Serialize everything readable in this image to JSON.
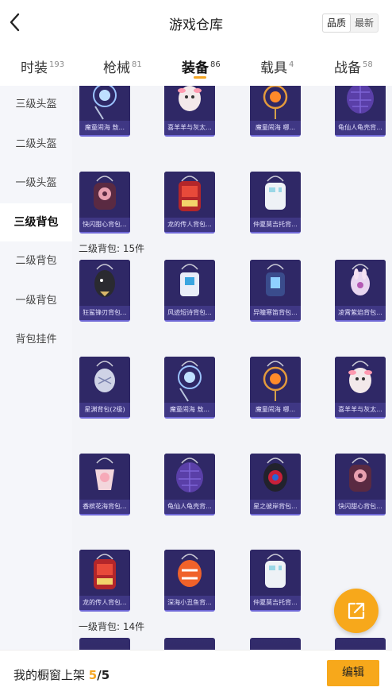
{
  "header": {
    "title": "游戏仓库",
    "sort_options": [
      "品质",
      "最新"
    ],
    "sort_selected": "品质"
  },
  "tabs": [
    {
      "label": "时装",
      "count": "193"
    },
    {
      "label": "枪械",
      "count": "81"
    },
    {
      "label": "装备",
      "count": "86",
      "active": true
    },
    {
      "label": "载具",
      "count": "4"
    },
    {
      "label": "战备",
      "count": "58"
    }
  ],
  "sidebar": {
    "items": [
      "三级头盔",
      "二级头盔",
      "一级头盔",
      "三级背包",
      "二级背包",
      "一级背包",
      "背包挂件"
    ],
    "active": "三级背包"
  },
  "sections": {
    "level2_title": "二级背包: 15件",
    "level1_title": "一级背包: 14件"
  },
  "items_top": [
    {
      "name": "魔童闹海 敖...",
      "icon": "blue-orb-backpack"
    },
    {
      "name": "喜羊羊与灰太...",
      "icon": "sheep-backpack"
    },
    {
      "name": "魔童闹海 哪...",
      "icon": "orange-orb-backpack"
    },
    {
      "name": "龟仙人龟壳背...",
      "icon": "turtle-shell-backpack"
    },
    {
      "name": "快闪甜心背包...",
      "icon": "pink-bear-backpack"
    },
    {
      "name": "龙的传人背包...",
      "icon": "red-dragon-backpack"
    },
    {
      "name": "仲夏莫吉托背...",
      "icon": "white-ice-backpack"
    }
  ],
  "items_level2": [
    {
      "name": "狂鲨锋刃背包...",
      "icon": "shark-backpack"
    },
    {
      "name": "风迹短诗背包...",
      "icon": "white-poem-backpack"
    },
    {
      "name": "异瞳寒笛背包...",
      "icon": "blue-flute-backpack"
    },
    {
      "name": "凌霄紫焰背包...",
      "icon": "purple-flame-backpack"
    },
    {
      "name": "星渊背包(2级)",
      "icon": "star-abyss-backpack"
    },
    {
      "name": "魔童闹海 敖...",
      "icon": "blue-orb-backpack"
    },
    {
      "name": "魔童闹海 哪...",
      "icon": "orange-orb-backpack"
    },
    {
      "name": "喜羊羊与灰太...",
      "icon": "sheep-backpack"
    },
    {
      "name": "香槟花海背包...",
      "icon": "flower-backpack"
    },
    {
      "name": "龟仙人龟壳背...",
      "icon": "turtle-shell-backpack"
    },
    {
      "name": "星之彼岸背包...",
      "icon": "star-shore-backpack"
    },
    {
      "name": "快闪甜心背包...",
      "icon": "pink-bear-backpack"
    },
    {
      "name": "龙的传人背包...",
      "icon": "red-dragon-backpack"
    },
    {
      "name": "深海小丑鱼背...",
      "icon": "clownfish-backpack"
    },
    {
      "name": "仲夏莫吉托背...",
      "icon": "white-ice-backpack"
    }
  ],
  "bottom": {
    "label": "我的橱窗上架",
    "current": "5",
    "total": "5",
    "edit_label": "编辑"
  },
  "colors": {
    "accent": "#f7a81b",
    "card_bg": "#2f2866",
    "card_border": "#6f68d6"
  }
}
